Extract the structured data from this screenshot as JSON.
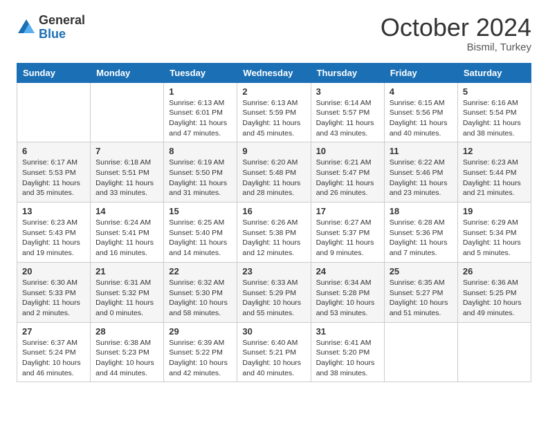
{
  "header": {
    "logo_general": "General",
    "logo_blue": "Blue",
    "month": "October 2024",
    "location": "Bismil, Turkey"
  },
  "weekdays": [
    "Sunday",
    "Monday",
    "Tuesday",
    "Wednesday",
    "Thursday",
    "Friday",
    "Saturday"
  ],
  "weeks": [
    [
      {
        "day": "",
        "info": ""
      },
      {
        "day": "",
        "info": ""
      },
      {
        "day": "1",
        "info": "Sunrise: 6:13 AM\nSunset: 6:01 PM\nDaylight: 11 hours and 47 minutes."
      },
      {
        "day": "2",
        "info": "Sunrise: 6:13 AM\nSunset: 5:59 PM\nDaylight: 11 hours and 45 minutes."
      },
      {
        "day": "3",
        "info": "Sunrise: 6:14 AM\nSunset: 5:57 PM\nDaylight: 11 hours and 43 minutes."
      },
      {
        "day": "4",
        "info": "Sunrise: 6:15 AM\nSunset: 5:56 PM\nDaylight: 11 hours and 40 minutes."
      },
      {
        "day": "5",
        "info": "Sunrise: 6:16 AM\nSunset: 5:54 PM\nDaylight: 11 hours and 38 minutes."
      }
    ],
    [
      {
        "day": "6",
        "info": "Sunrise: 6:17 AM\nSunset: 5:53 PM\nDaylight: 11 hours and 35 minutes."
      },
      {
        "day": "7",
        "info": "Sunrise: 6:18 AM\nSunset: 5:51 PM\nDaylight: 11 hours and 33 minutes."
      },
      {
        "day": "8",
        "info": "Sunrise: 6:19 AM\nSunset: 5:50 PM\nDaylight: 11 hours and 31 minutes."
      },
      {
        "day": "9",
        "info": "Sunrise: 6:20 AM\nSunset: 5:48 PM\nDaylight: 11 hours and 28 minutes."
      },
      {
        "day": "10",
        "info": "Sunrise: 6:21 AM\nSunset: 5:47 PM\nDaylight: 11 hours and 26 minutes."
      },
      {
        "day": "11",
        "info": "Sunrise: 6:22 AM\nSunset: 5:46 PM\nDaylight: 11 hours and 23 minutes."
      },
      {
        "day": "12",
        "info": "Sunrise: 6:23 AM\nSunset: 5:44 PM\nDaylight: 11 hours and 21 minutes."
      }
    ],
    [
      {
        "day": "13",
        "info": "Sunrise: 6:23 AM\nSunset: 5:43 PM\nDaylight: 11 hours and 19 minutes."
      },
      {
        "day": "14",
        "info": "Sunrise: 6:24 AM\nSunset: 5:41 PM\nDaylight: 11 hours and 16 minutes."
      },
      {
        "day": "15",
        "info": "Sunrise: 6:25 AM\nSunset: 5:40 PM\nDaylight: 11 hours and 14 minutes."
      },
      {
        "day": "16",
        "info": "Sunrise: 6:26 AM\nSunset: 5:38 PM\nDaylight: 11 hours and 12 minutes."
      },
      {
        "day": "17",
        "info": "Sunrise: 6:27 AM\nSunset: 5:37 PM\nDaylight: 11 hours and 9 minutes."
      },
      {
        "day": "18",
        "info": "Sunrise: 6:28 AM\nSunset: 5:36 PM\nDaylight: 11 hours and 7 minutes."
      },
      {
        "day": "19",
        "info": "Sunrise: 6:29 AM\nSunset: 5:34 PM\nDaylight: 11 hours and 5 minutes."
      }
    ],
    [
      {
        "day": "20",
        "info": "Sunrise: 6:30 AM\nSunset: 5:33 PM\nDaylight: 11 hours and 2 minutes."
      },
      {
        "day": "21",
        "info": "Sunrise: 6:31 AM\nSunset: 5:32 PM\nDaylight: 11 hours and 0 minutes."
      },
      {
        "day": "22",
        "info": "Sunrise: 6:32 AM\nSunset: 5:30 PM\nDaylight: 10 hours and 58 minutes."
      },
      {
        "day": "23",
        "info": "Sunrise: 6:33 AM\nSunset: 5:29 PM\nDaylight: 10 hours and 55 minutes."
      },
      {
        "day": "24",
        "info": "Sunrise: 6:34 AM\nSunset: 5:28 PM\nDaylight: 10 hours and 53 minutes."
      },
      {
        "day": "25",
        "info": "Sunrise: 6:35 AM\nSunset: 5:27 PM\nDaylight: 10 hours and 51 minutes."
      },
      {
        "day": "26",
        "info": "Sunrise: 6:36 AM\nSunset: 5:25 PM\nDaylight: 10 hours and 49 minutes."
      }
    ],
    [
      {
        "day": "27",
        "info": "Sunrise: 6:37 AM\nSunset: 5:24 PM\nDaylight: 10 hours and 46 minutes."
      },
      {
        "day": "28",
        "info": "Sunrise: 6:38 AM\nSunset: 5:23 PM\nDaylight: 10 hours and 44 minutes."
      },
      {
        "day": "29",
        "info": "Sunrise: 6:39 AM\nSunset: 5:22 PM\nDaylight: 10 hours and 42 minutes."
      },
      {
        "day": "30",
        "info": "Sunrise: 6:40 AM\nSunset: 5:21 PM\nDaylight: 10 hours and 40 minutes."
      },
      {
        "day": "31",
        "info": "Sunrise: 6:41 AM\nSunset: 5:20 PM\nDaylight: 10 hours and 38 minutes."
      },
      {
        "day": "",
        "info": ""
      },
      {
        "day": "",
        "info": ""
      }
    ]
  ]
}
